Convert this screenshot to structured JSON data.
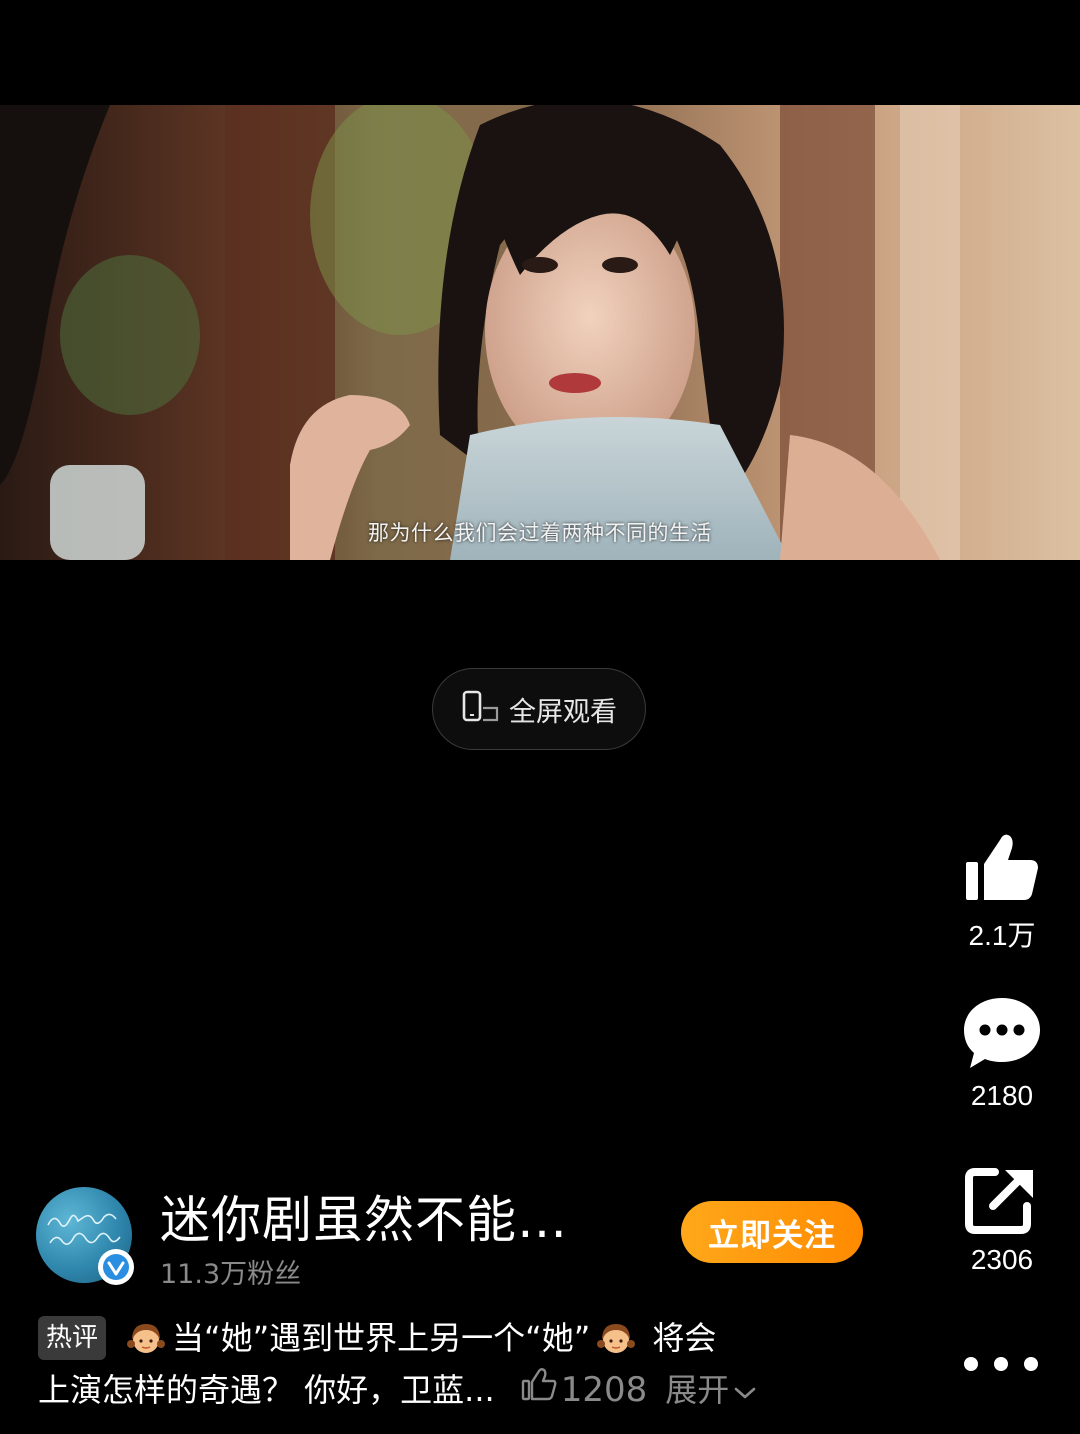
{
  "video": {
    "subtitle": "那为什么我们会过着两种不同的生活"
  },
  "fullscreen": {
    "label": "全屏观看",
    "icon": "rotate-phone-icon"
  },
  "actions": {
    "like": {
      "icon": "thumbs-up-icon",
      "count": "2.1万"
    },
    "comment": {
      "icon": "comment-bubble-icon",
      "count": "2180"
    },
    "share": {
      "icon": "share-icon",
      "count": "2306"
    },
    "more": {
      "icon": "more-dots-icon"
    }
  },
  "author": {
    "name": "迷你剧虽然不能…",
    "followers": "11.3万粉丝",
    "follow_label": "立即关注",
    "verified": true
  },
  "hot_comment": {
    "tag": "热评",
    "line1_a": "当“她”遇到世界上另一个“她”",
    "line1_b": "将会",
    "line2": "上演怎样的奇遇？ 你好，卫蓝...",
    "likes": "1208",
    "expand_label": "展开"
  },
  "colors": {
    "background": "#000000",
    "follow_button": "#ff9a0a",
    "muted_text": "#8a8a8a"
  }
}
